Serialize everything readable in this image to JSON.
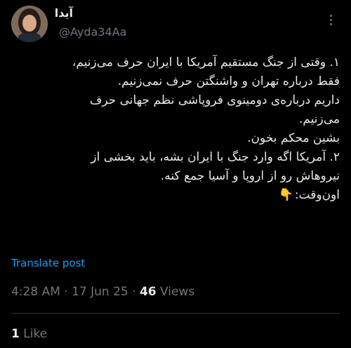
{
  "author": {
    "display_name": "آیدا",
    "handle": "@Ayda34Aa"
  },
  "post": {
    "lines": [
      "۱. وقتی از جنگ مستقیم آمریکا با ایران حرف می‌زنیم،",
      "فقط درباره تهران و واشنگتن حرف نمی‌زنیم.",
      "داریم درباره‌ی دومینوی فروپاشی نظم جهانی حرف",
      "می‌زنیم.",
      "بشین محکم بخون.",
      "۲. آمریکا اگه وارد جنگ با ایران بشه، باید بخشی از",
      "نیروهاش رو از اروپا و آسیا جمع کنه."
    ],
    "last_line": "اون‌وقت:",
    "emoji": "👇"
  },
  "actions": {
    "translate_label": "Translate post"
  },
  "meta": {
    "time": "4:28 AM",
    "date": "17 Jun 25",
    "views_count": "46",
    "views_label": "Views"
  },
  "engagement": {
    "likes_count": "1",
    "likes_label": "Like"
  },
  "icons": {
    "more": "more-horizontal-icon"
  }
}
